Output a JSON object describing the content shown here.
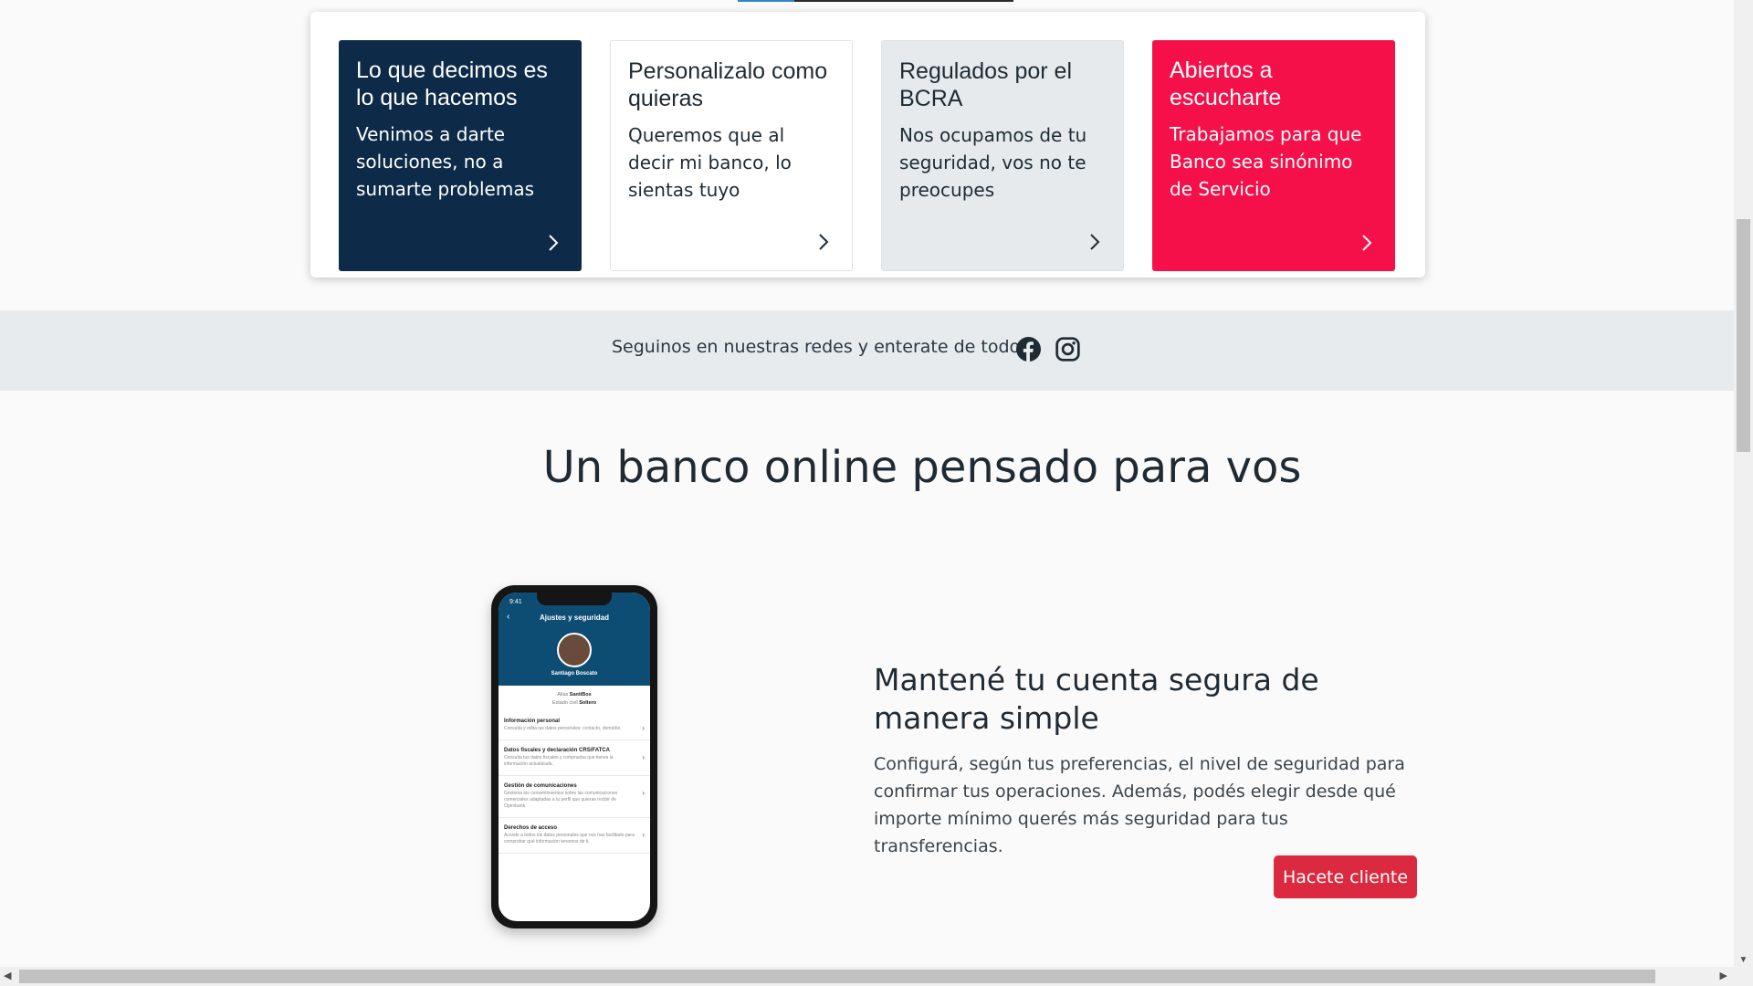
{
  "cards": [
    {
      "title": "Lo que decimos es lo que hacemos",
      "text": "Venimos a darte soluciones, no a sumarte problemas",
      "background": "#0d2b48"
    },
    {
      "title": "Personalizalo como quieras",
      "text": "Queremos que al decir mi banco, lo sientas tuyo",
      "background": "#ffffff"
    },
    {
      "title": "Regulados por el BCRA",
      "text": "Nos ocupamos de tu seguridad, vos no te preocupes",
      "background": "#e6eaec"
    },
    {
      "title": "Abiertos a escucharte",
      "text": "Trabajamos para que Banco sea sinónimo de Servicio",
      "background": "#f5104a"
    }
  ],
  "social": {
    "text": "Seguinos en nuestras redes y enterate de todo",
    "icons": [
      "facebook-icon",
      "instagram-icon"
    ]
  },
  "headline": "Un banco online pensado para vos",
  "phone": {
    "time": "9:41",
    "title": "Ajustes y seguridad",
    "user_name": "Santiago Boscato",
    "alias_label": "Alias",
    "alias_value": "SantiBos",
    "civil_label": "Estado civil",
    "civil_value": "Soltero",
    "items": [
      {
        "title": "Información personal",
        "desc": "Consulta y edita tus datos personales: contacto, domicilio."
      },
      {
        "title": "Datos fiscales y declaración CRS/FATCA",
        "desc": "Consulta tus datos fiscales y comprueba que tienes la información actualizada."
      },
      {
        "title": "Gestión de comunicaciones",
        "desc": "Gestiona los consentimientos sobre las comunicaciones comerciales adaptadas a tu perfil que quieras recibir de Openbank."
      },
      {
        "title": "Derechos de acceso",
        "desc": "Accede a todos los datos personales que nos has facilitado para comprobar qué información tenemos de ti."
      }
    ]
  },
  "feature": {
    "title": "Mantené tu cuenta segura de manera simple",
    "text": "Configurá, según tus preferencias, el nivel de seguridad para confirmar tus operaciones. Además, podés elegir desde qué importe mínimo querés más seguridad para tus transferencias.",
    "cta": "Hacete cliente",
    "cta_color": "#db2a3f"
  }
}
